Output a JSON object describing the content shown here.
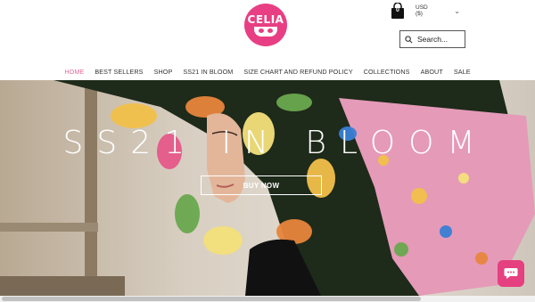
{
  "brand": {
    "logo_text": "CELIA",
    "logo_color": "#e83f84"
  },
  "header": {
    "cart_count": "0",
    "currency": "USD ($)",
    "search_placeholder": "Search..."
  },
  "nav": {
    "items": [
      {
        "label": "HOME",
        "active": true
      },
      {
        "label": "BEST SELLERS"
      },
      {
        "label": "SHOP"
      },
      {
        "label": "SS21 IN BLOOM"
      },
      {
        "label": "SIZE CHART AND REFUND POLICY"
      },
      {
        "label": "COLLECTIONS"
      },
      {
        "label": "ABOUT"
      },
      {
        "label": "SALE"
      }
    ]
  },
  "hero": {
    "title": "SS21 IN BLOOM",
    "button_label": "BUY NOW"
  },
  "colors": {
    "accent": "#e5407f",
    "active_nav": "#e06b9a"
  }
}
